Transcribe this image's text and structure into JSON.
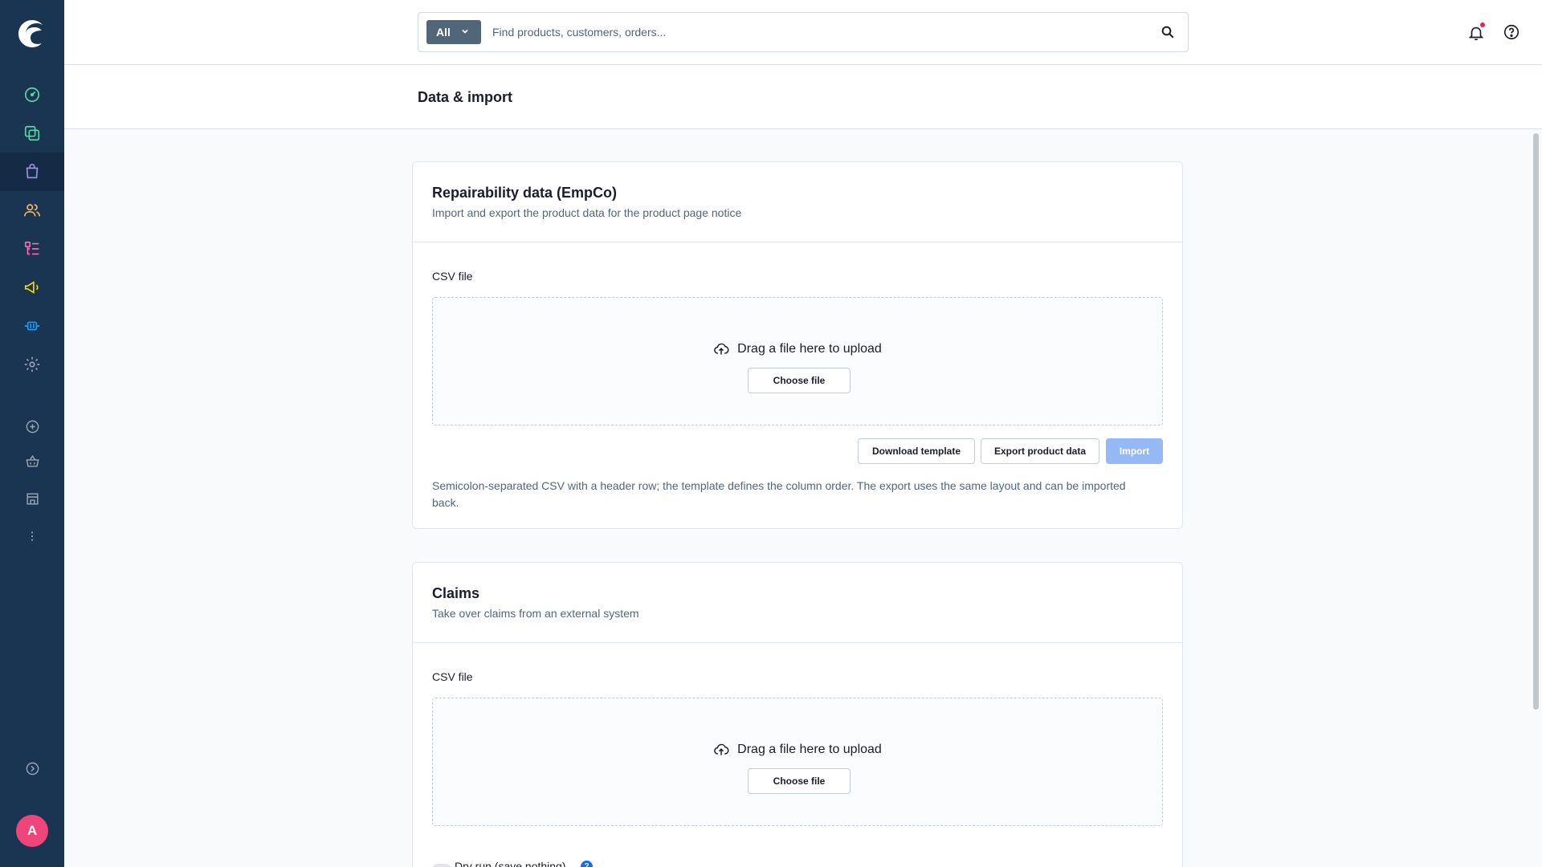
{
  "search": {
    "type_label": "All",
    "placeholder": "Find products, customers, orders..."
  },
  "page": {
    "title": "Data & import"
  },
  "sidebar": {
    "items": [
      {
        "icon": "dashboard-icon",
        "color": "#57d9a3"
      },
      {
        "icon": "catalogues-icon",
        "color": "#57d9a3"
      },
      {
        "icon": "orders-icon",
        "color": "#a092f0",
        "active": true
      },
      {
        "icon": "customers-icon",
        "color": "#ffb75d"
      },
      {
        "icon": "content-icon",
        "color": "#ff68b4"
      },
      {
        "icon": "marketing-icon",
        "color": "#ffd700"
      },
      {
        "icon": "extensions-icon",
        "color": "#189eff"
      },
      {
        "icon": "settings-icon",
        "color": "#9aa8b5"
      }
    ],
    "avatar_letter": "A"
  },
  "cards": [
    {
      "title": "Repairability data (EmpCo)",
      "subtitle": "Import and export the product data for the product page notice",
      "field_label": "CSV file",
      "dropzone_text": "Drag a file here to upload",
      "choose_label": "Choose file",
      "download_label": "Download template",
      "export_label": "Export product data",
      "import_label": "Import",
      "help": "Semicolon-separated CSV with a header row; the template defines the column order. The export uses the same layout and can be imported back."
    },
    {
      "title": "Claims",
      "subtitle": "Take over claims from an external system",
      "field_label": "CSV file",
      "dropzone_text": "Drag a file here to upload",
      "choose_label": "Choose file",
      "dry_run_label": "Dry run (save nothing)",
      "info_glyph": "?"
    }
  ],
  "colors": {
    "sidebar": "#1a3552",
    "accent": "#0870ff",
    "import_disabled": "#94b9f5",
    "avatar": "#f0457a"
  }
}
